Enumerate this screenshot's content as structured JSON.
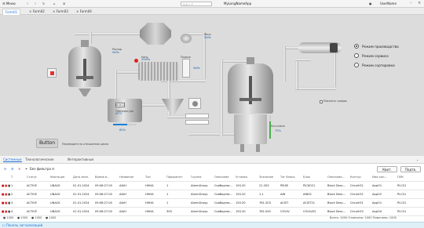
{
  "titlebar": {
    "menu": "Меню",
    "search_placeholder": "Crtl + F",
    "app_name": "MyLongNameApp",
    "user": "UserName"
  },
  "tabs": [
    "Form01",
    "Form02",
    "Form03",
    "Form04"
  ],
  "scada": {
    "l_vesy": "Весы",
    "v_vesy": "5kPa",
    "l_flow": "Расход",
    "v_flow": "5kPa",
    "l_m1": "Нагр.",
    "v_m1": "25kPa",
    "l_press": "Подача",
    "v_press": "5kPa",
    "l_temp": "Температура",
    "v_temp": "45°C",
    "v_level": "60%",
    "l_tank2": "Кол.смеси",
    "v_level2": "75%",
    "l_hide": "Показать график",
    "modes": [
      "Режим производства",
      "Режим сервиса",
      "Режим сортировки"
    ],
    "mode_selected": 0,
    "button_label": "Button",
    "button_hint": "Переведите по отношению цикла",
    "mini_btn": "Button"
  },
  "panel": {
    "tabs": [
      "Системные",
      "Технологические",
      "Интерактивные"
    ],
    "filter": "Без фильтра",
    "btn_ack": "Квит.",
    "btn_print": "Подтв.",
    "columns": [
      "Т",
      "Статус",
      "Квитация",
      "Дата возн.",
      "Время в...",
      "Название",
      "Тип",
      "Приоритет",
      "Группа",
      "Описание",
      "Уставка",
      "Значение",
      "Тег блока",
      "Блок",
      "Описание...",
      "Контур",
      "Имя кон...",
      "ПЛК"
    ],
    "rows": [
      [
        "1",
        "ACTIVE",
        "UNACK",
        "01.01.2024",
        "09:08:27.00",
        "AIAH",
        "HHHA",
        "1",
        "AlarmGroup",
        "Сообщени...",
        "150.20",
        "21.203",
        "PIEXE",
        "PICKO21",
        "Block Desc...",
        "CircuitO1",
        "AppO1",
        "PLC01"
      ],
      [
        "2",
        "ACTIVE",
        "UNACK",
        "01.01.2024",
        "09:08:27.00",
        "AIAH",
        "HHHA",
        "1",
        "AlarmGroup",
        "Сообщени...",
        "150.20",
        "1.1",
        "AIN",
        "AIN02",
        "Block Desc...",
        "CircuitO2",
        "AppO2",
        "PLC01"
      ],
      [
        "3",
        "ACTIVE",
        "UNACK",
        "01.01.2024",
        "09:08:27.00",
        "AIAH",
        "HHHA",
        "1",
        "AlarmGroup",
        "Сообщени...",
        "150.20",
        "761.203",
        "ACIST",
        "ACIST21",
        "Block Desc...",
        "CircuitO1",
        "AppO1",
        "PLC01"
      ],
      [
        "4",
        "ACTIVE",
        "UNACK",
        "01.01.2024",
        "09:08:27.00",
        "AIAH",
        "HHHA",
        "300",
        "AlarmGroup",
        "Сообщени...",
        "150.20",
        "761.045",
        "COVLV",
        "COVLV02",
        "Block Desc...",
        "CircuitO3",
        "AppO4",
        "PLC01"
      ]
    ],
    "status_left": [
      "1000",
      "1000",
      "1000",
      "1000"
    ],
    "status_right": "Всего: 1000  Отмечено: 1000  Помечено: 1000",
    "bottom": "Панель сигнализаций"
  }
}
